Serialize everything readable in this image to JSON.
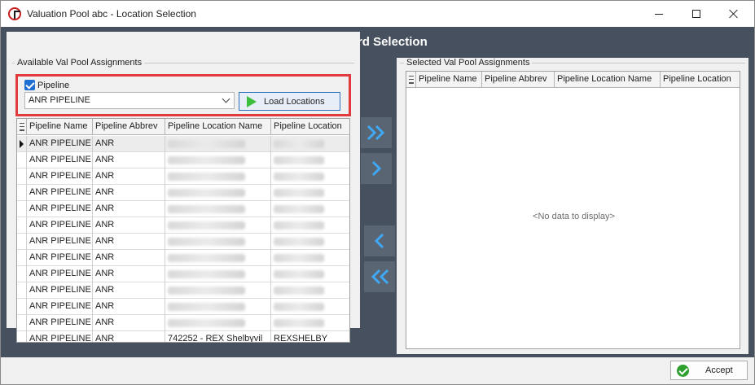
{
  "window": {
    "title": "Valuation Pool abc - Location Selection"
  },
  "banner": "Record Selection",
  "available": {
    "title": "Available Val Pool Assignments",
    "pipeline_label": "Pipeline",
    "pipeline_checked": true,
    "pipeline_value": "ANR PIPELINE",
    "load_label": "Load Locations",
    "columns": [
      "Pipeline Name",
      "Pipeline Abbrev",
      "Pipeline Location Name",
      "Pipeline Location"
    ],
    "rows": [
      [
        "ANR PIPELINE",
        "ANR",
        "",
        ""
      ],
      [
        "ANR PIPELINE",
        "ANR",
        "",
        ""
      ],
      [
        "ANR PIPELINE",
        "ANR",
        "",
        ""
      ],
      [
        "ANR PIPELINE",
        "ANR",
        "",
        ""
      ],
      [
        "ANR PIPELINE",
        "ANR",
        "",
        ""
      ],
      [
        "ANR PIPELINE",
        "ANR",
        "",
        ""
      ],
      [
        "ANR PIPELINE",
        "ANR",
        "",
        ""
      ],
      [
        "ANR PIPELINE",
        "ANR",
        "",
        ""
      ],
      [
        "ANR PIPELINE",
        "ANR",
        "",
        ""
      ],
      [
        "ANR PIPELINE",
        "ANR",
        "",
        ""
      ],
      [
        "ANR PIPELINE",
        "ANR",
        "",
        ""
      ],
      [
        "ANR PIPELINE",
        "ANR",
        "",
        ""
      ],
      [
        "ANR PIPELINE",
        "ANR",
        "742252 - REX Shelbyvil",
        "REXSHELBY"
      ]
    ]
  },
  "selected": {
    "title": "Selected Val Pool Assignments",
    "columns": [
      "Pipeline Name",
      "Pipeline Abbrev",
      "Pipeline Location Name",
      "Pipeline Location"
    ],
    "empty_text": "<No data to display>"
  },
  "footer": {
    "accept_label": "Accept"
  },
  "colors": {
    "banner_bg": "#46505e",
    "highlight_box": "#e0393e",
    "move_button": "#5a6573",
    "arrow": "#3fa9f5"
  }
}
